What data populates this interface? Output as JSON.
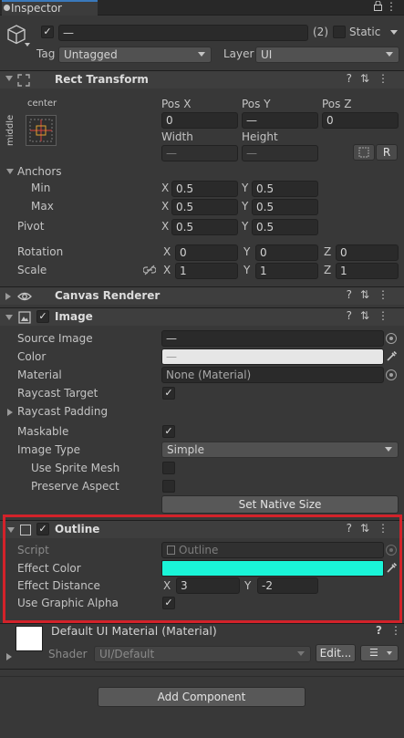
{
  "window": {
    "tab_title": "Inspector",
    "tab_icons": "⋮ ⋮"
  },
  "object": {
    "name_value": "—",
    "count": "(2)",
    "static_label": "Static",
    "tag_label": "Tag",
    "tag_value": "Untagged",
    "layer_label": "Layer",
    "layer_value": "UI"
  },
  "rect_transform": {
    "title": "Rect Transform",
    "anchor_h": "center",
    "anchor_v": "middle",
    "pos_x_label": "Pos X",
    "pos_y_label": "Pos Y",
    "pos_z_label": "Pos Z",
    "pos_x": "0",
    "pos_y": "—",
    "pos_z": "0",
    "width_label": "Width",
    "height_label": "Height",
    "width": "—",
    "height": "—",
    "r_button": "R",
    "anchors_label": "Anchors",
    "min_label": "Min",
    "max_label": "Max",
    "pivot_label": "Pivot",
    "min_x": "0.5",
    "min_y": "0.5",
    "max_x": "0.5",
    "max_y": "0.5",
    "pivot_x": "0.5",
    "pivot_y": "0.5",
    "rotation_label": "Rotation",
    "scale_label": "Scale",
    "rot_x": "0",
    "rot_y": "0",
    "rot_z": "0",
    "scale_x": "1",
    "scale_y": "1",
    "scale_z": "1",
    "x": "X",
    "y": "Y",
    "z": "Z"
  },
  "canvas_renderer": {
    "title": "Canvas Renderer"
  },
  "image": {
    "title": "Image",
    "source_image_label": "Source Image",
    "source_image_value": "—",
    "color_label": "Color",
    "color_value": "—",
    "material_label": "Material",
    "material_value": "None (Material)",
    "raycast_target_label": "Raycast Target",
    "raycast_padding_label": "Raycast Padding",
    "maskable_label": "Maskable",
    "image_type_label": "Image Type",
    "image_type_value": "Simple",
    "use_sprite_mesh_label": "Use Sprite Mesh",
    "preserve_aspect_label": "Preserve Aspect",
    "set_native_size": "Set Native Size"
  },
  "outline": {
    "title": "Outline",
    "script_label": "Script",
    "script_value": "Outline",
    "effect_color_label": "Effect Color",
    "effect_color": "#1af5d8",
    "effect_distance_label": "Effect Distance",
    "dist_x": "3",
    "dist_y": "-2",
    "use_graphic_alpha_label": "Use Graphic Alpha"
  },
  "material_section": {
    "title": "Default UI Material (Material)",
    "shader_label": "Shader",
    "shader_value": "UI/Default",
    "edit_button": "Edit...",
    "list_icon": "☰"
  },
  "add_component": "Add Component",
  "icons": {
    "help": "?",
    "preset": "⇅",
    "menu": "⋮",
    "check": "✓",
    "lock": "🔒",
    "link": "⊘"
  }
}
